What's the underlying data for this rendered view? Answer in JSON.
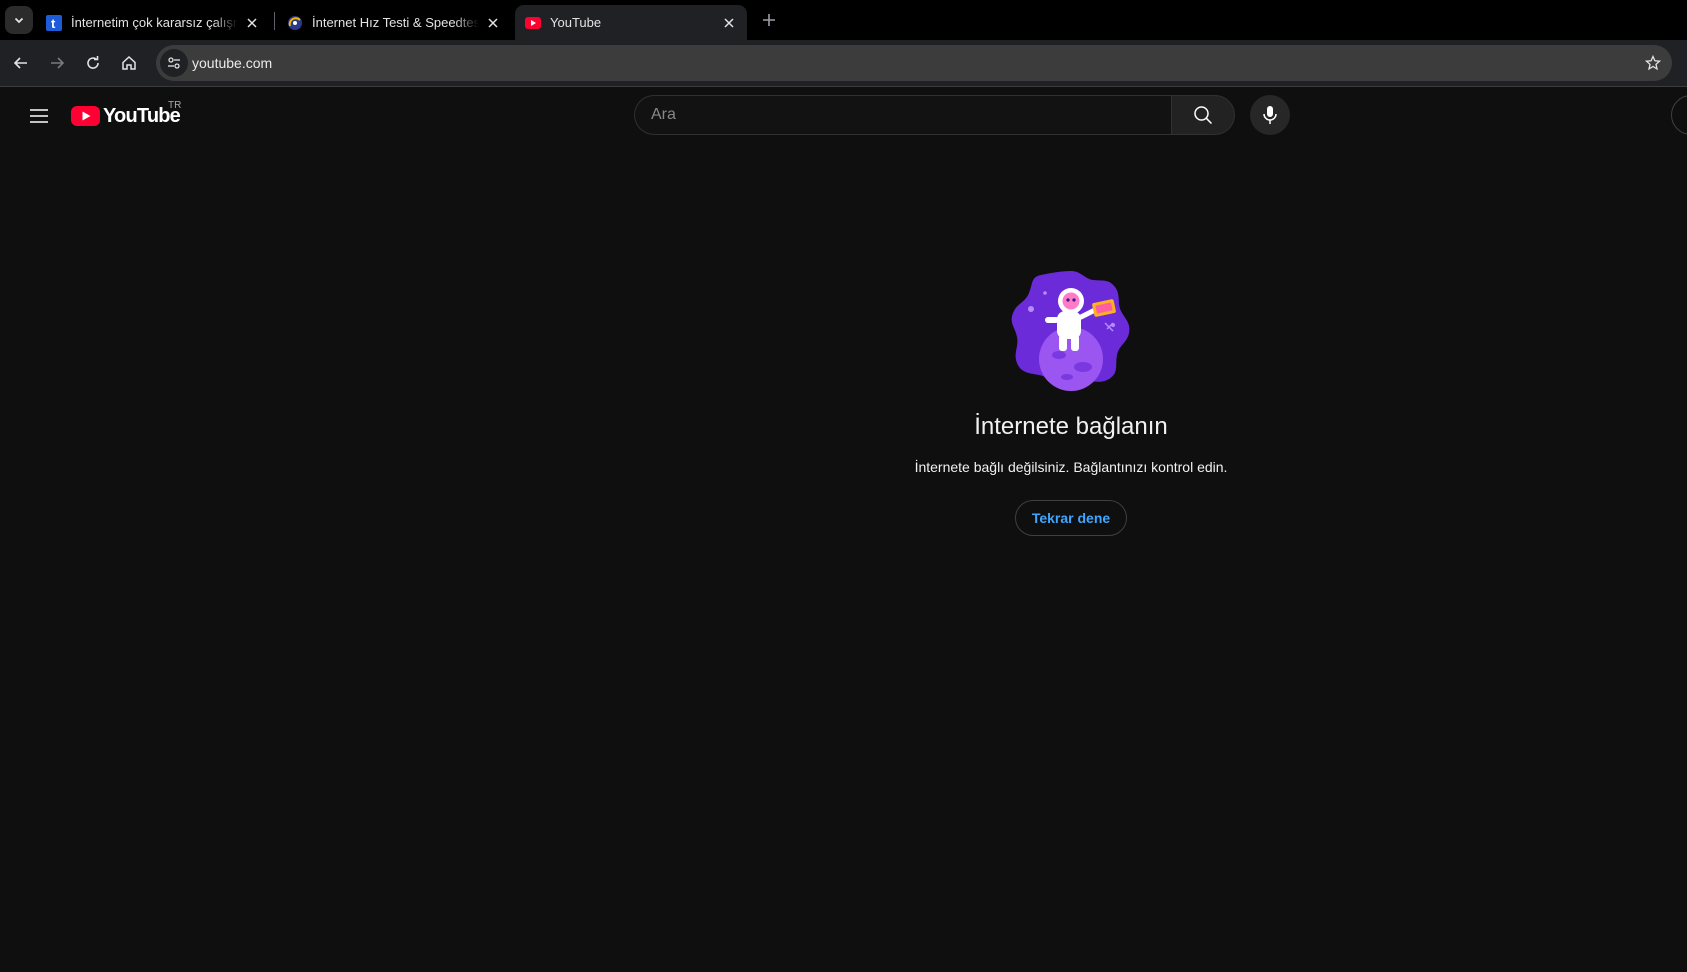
{
  "browser": {
    "tabs": [
      {
        "title": "İnternetim çok kararsız çalışmay",
        "favicon": "t-favicon",
        "active": false
      },
      {
        "title": "İnternet Hız Testi & Speedtest -",
        "favicon": "speedtest-favicon",
        "active": false
      },
      {
        "title": "YouTube",
        "favicon": "youtube-favicon",
        "active": true
      }
    ],
    "url": "youtube.com"
  },
  "youtube": {
    "logo_text": "YouTube",
    "country_code": "TR",
    "search_placeholder": "Ara",
    "offline": {
      "title": "İnternete bağlanın",
      "message": "İnternete bağlı değilsiniz. Bağlantınızı kontrol edin.",
      "retry_label": "Tekrar dene"
    }
  },
  "colors": {
    "page_bg": "#0f0f0f",
    "brand_red": "#ff0033",
    "link_blue": "#3ea6ff",
    "illustration_purple": "#6c2bd9"
  }
}
